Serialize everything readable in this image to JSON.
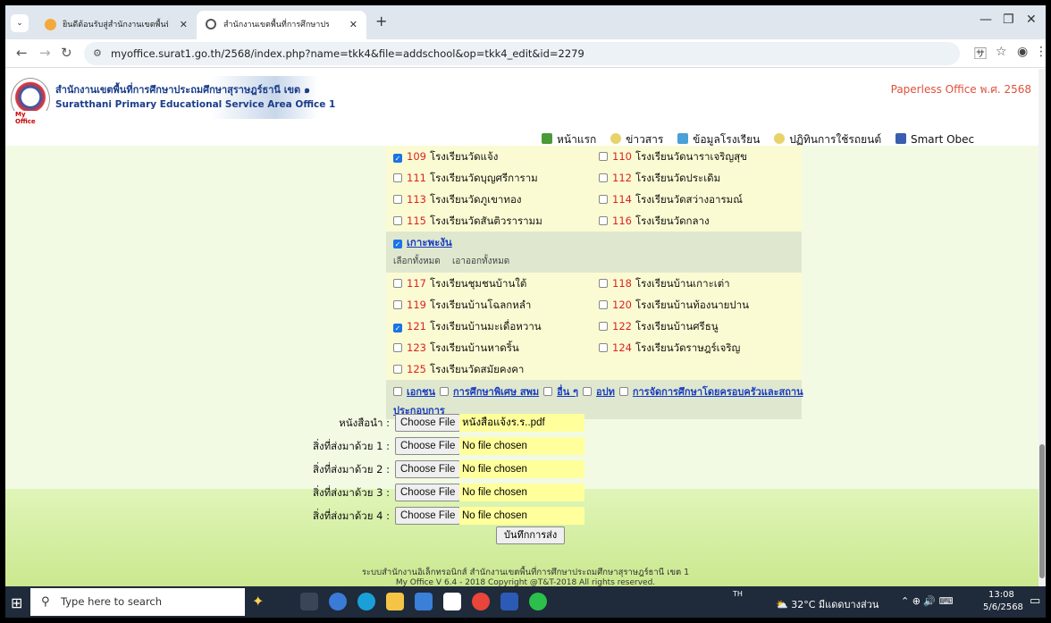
{
  "browser": {
    "tabs": [
      {
        "title": "ยินดีต้อนรับสู่สำนักงานเขตพื้นที่การศึกษาประถมศึกษา",
        "active": false
      },
      {
        "title": "สำนักงานเขตพื้นที่การศึกษาประถมศึกษา",
        "active": true
      }
    ],
    "new_tab": "+",
    "url": "myoffice.surat1.go.th/2568/index.php?name=tkk4&file=addschool&op=tkk4_edit&id=2279"
  },
  "header": {
    "org_th": "สำนักงานเขตพื้นที่การศึกษาประถมศึกษาสุราษฎร์ธานี เขต ๑",
    "org_en": "Suratthani Primary Educational Service Area Office 1",
    "logo_text": "My Office",
    "paperless": "Paperless Office พ.ศ. 2568"
  },
  "nav": [
    "หน้าแรก",
    "ข่าวสาร",
    "ข้อมูลโรงเรียน",
    "ปฏิทินการใช้รถยนต์",
    "Smart Obec"
  ],
  "schools_top": [
    [
      {
        "num": "109",
        "name": "โรงเรียนวัดแจ้ง",
        "checked": true
      },
      {
        "num": "110",
        "name": "โรงเรียนวัดนาราเจริญสุข",
        "checked": false
      }
    ],
    [
      {
        "num": "111",
        "name": "โรงเรียนวัดบุญศรีการาม",
        "checked": false
      },
      {
        "num": "112",
        "name": "โรงเรียนวัดประเดิม",
        "checked": false
      }
    ],
    [
      {
        "num": "113",
        "name": "โรงเรียนวัดภูเขาทอง",
        "checked": false
      },
      {
        "num": "114",
        "name": "โรงเรียนวัดสว่างอารมณ์",
        "checked": false
      }
    ],
    [
      {
        "num": "115",
        "name": "โรงเรียนวัดสันติวรารามม",
        "checked": false
      },
      {
        "num": "116",
        "name": "โรงเรียนวัดกลาง",
        "checked": false
      }
    ]
  ],
  "group": {
    "title": "เกาะพะงัน",
    "select_all": "เลือกทั้งหมด",
    "deselect_all": "เอาออกทั้งหมด"
  },
  "schools_bottom": [
    [
      {
        "num": "117",
        "name": "โรงเรียนชุมชนบ้านใต้",
        "checked": false
      },
      {
        "num": "118",
        "name": "โรงเรียนบ้านเกาะเต่า",
        "checked": false
      }
    ],
    [
      {
        "num": "119",
        "name": "โรงเรียนบ้านโฉลกหลำ",
        "checked": false
      },
      {
        "num": "120",
        "name": "โรงเรียนบ้านท้องนายปาน",
        "checked": false
      }
    ],
    [
      {
        "num": "121",
        "name": "โรงเรียนบ้านมะเดื่อหวาน",
        "checked": true
      },
      {
        "num": "122",
        "name": "โรงเรียนบ้านศรีธนู",
        "checked": false
      }
    ],
    [
      {
        "num": "123",
        "name": "โรงเรียนบ้านหาดริ้น",
        "checked": false
      },
      {
        "num": "124",
        "name": "โรงเรียนวัดราษฎร์เจริญ",
        "checked": false
      }
    ],
    [
      {
        "num": "125",
        "name": "โรงเรียนวัดสมัยคงคา",
        "checked": false
      }
    ]
  ],
  "categories": [
    "เอกชน",
    "การศึกษาพิเศษ สพม",
    "อื่น ๆ",
    "อปท",
    "การจัดการศึกษาโดยครอบครัวและสถาน"
  ],
  "categories_tail": "ประกอบการ",
  "files": [
    {
      "label": "หนังสือนำ :",
      "button": "Choose File",
      "value": "หนังสือแจ้งร.ร..pdf"
    },
    {
      "label": "สิ่งที่ส่งมาด้วย 1 :",
      "button": "Choose File",
      "value": "No file chosen"
    },
    {
      "label": "สิ่งที่ส่งมาด้วย 2 :",
      "button": "Choose File",
      "value": "No file chosen"
    },
    {
      "label": "สิ่งที่ส่งมาด้วย 3 :",
      "button": "Choose File",
      "value": "No file chosen"
    },
    {
      "label": "สิ่งที่ส่งมาด้วย 4 :",
      "button": "Choose File",
      "value": "No file chosen"
    }
  ],
  "submit": "บันทึกการส่ง",
  "footer": {
    "line1": "ระบบสำนักงานอิเล็กทรอนิกส์ สำนักงานเขตพื้นที่การศึกษาประถมศึกษาสุราษฎร์ธานี เขต 1",
    "line2": "My Office V 6.4 - 2018 Copyright @T&T-2018 All rights reserved."
  },
  "taskbar": {
    "search_placeholder": "Type here to search",
    "lang": "TH",
    "weather": "32°C มีแดดบางส่วน",
    "time": "13:08",
    "date": "5/6/2568"
  }
}
